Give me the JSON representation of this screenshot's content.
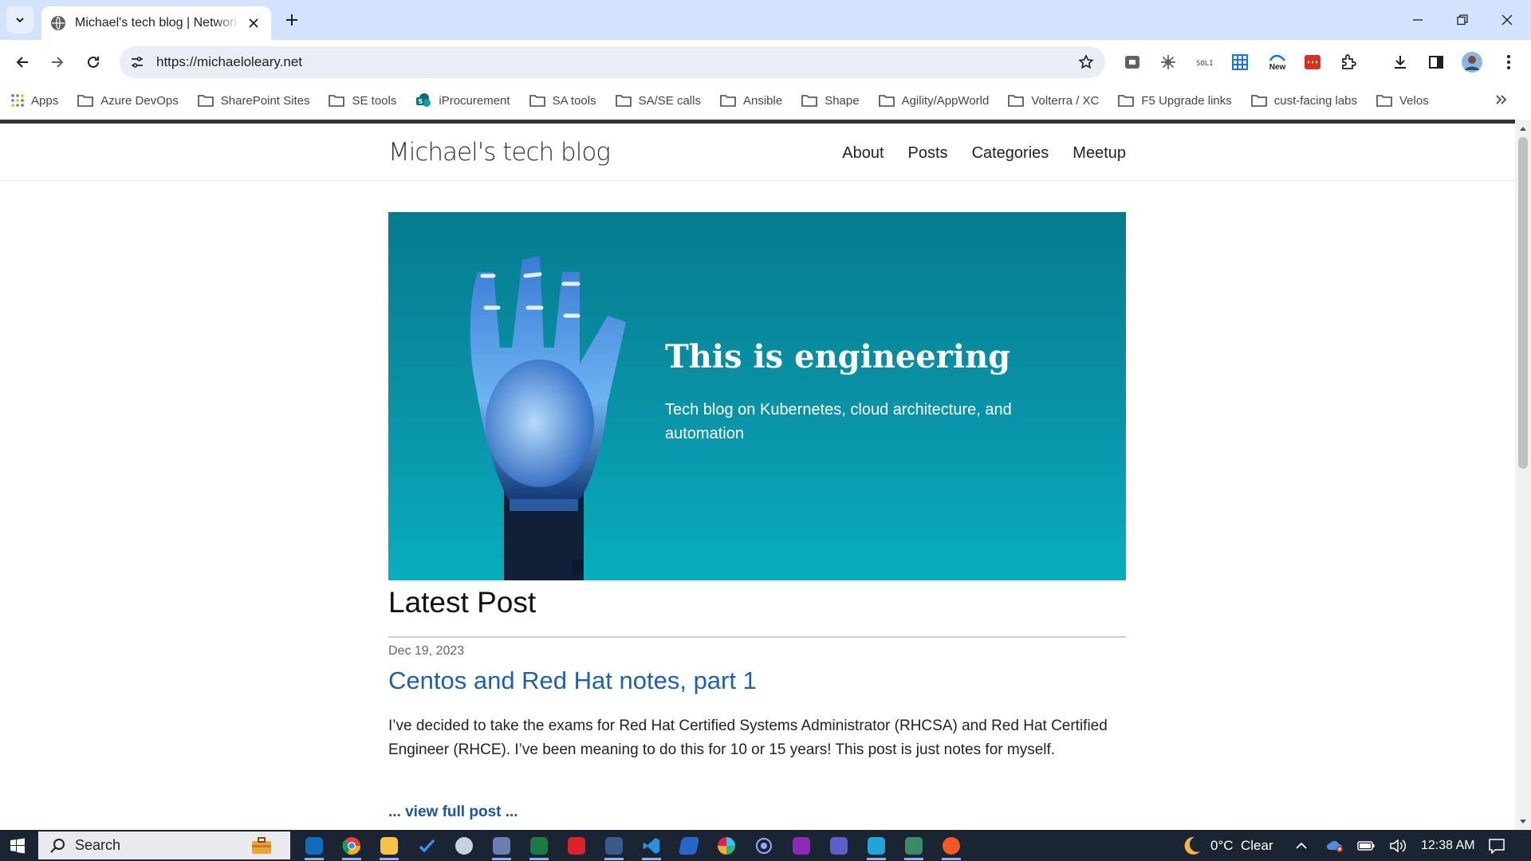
{
  "browser": {
    "tab_title": "Michael's tech blog | Network s",
    "url": "https://michaeloleary.net",
    "ext_new_label": "New",
    "bookmarks": [
      {
        "label": "Apps",
        "icon": "apps-grid-icon"
      },
      {
        "label": "Azure DevOps",
        "icon": "folder-icon"
      },
      {
        "label": "SharePoint Sites",
        "icon": "folder-icon"
      },
      {
        "label": "SE tools",
        "icon": "folder-icon"
      },
      {
        "label": "iProcurement",
        "icon": "sharepoint-icon"
      },
      {
        "label": "SA tools",
        "icon": "folder-icon"
      },
      {
        "label": "SA/SE calls",
        "icon": "folder-icon"
      },
      {
        "label": "Ansible",
        "icon": "folder-icon"
      },
      {
        "label": "Shape",
        "icon": "folder-icon"
      },
      {
        "label": "Agility/AppWorld",
        "icon": "folder-icon"
      },
      {
        "label": "Volterra / XC",
        "icon": "folder-icon"
      },
      {
        "label": "F5 Upgrade links",
        "icon": "folder-icon"
      },
      {
        "label": "cust-facing labs",
        "icon": "folder-icon"
      },
      {
        "label": "Velos",
        "icon": "folder-icon"
      }
    ]
  },
  "site": {
    "title": "Michael's tech blog",
    "nav": [
      "About",
      "Posts",
      "Categories",
      "Meetup"
    ]
  },
  "hero": {
    "title": "This is engineering",
    "subtitle": "Tech blog on Kubernetes, cloud architecture, and automation"
  },
  "latest": {
    "heading": "Latest Post",
    "date": "Dec 19, 2023",
    "post_title": "Centos and Red Hat notes, part 1",
    "excerpt": "I’ve decided to take the exams for Red Hat Certified Systems Administrator (RHCSA) and Red Hat Certified Engineer (RHCE). I’ve been meaning to do this for 10 or 15 years! This post is just notes for myself.",
    "read_more": "... view full post ..."
  },
  "taskbar": {
    "search_label": "Search",
    "weather": "0°C  Clear",
    "time": "12:38 AM"
  },
  "colors": {
    "tabstrip": "#d3e3fd",
    "link": "#1f5fae",
    "hero_top": "#067b8e",
    "hero_bottom": "#07aebd",
    "taskbar": "#1b2433"
  }
}
